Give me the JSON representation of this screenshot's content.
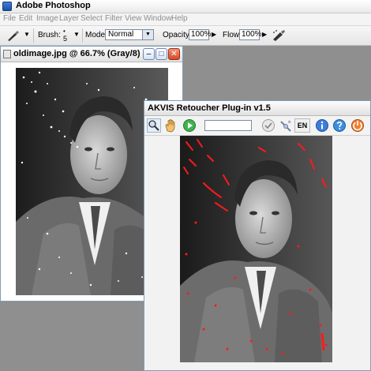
{
  "app": {
    "title": "Adobe Photoshop",
    "menu": [
      "File",
      "Edit",
      "Image",
      "Layer",
      "Select",
      "Filter",
      "View",
      "Window",
      "Help"
    ]
  },
  "options": {
    "brush_label": "Brush:",
    "brush_size": "5",
    "mode_label": "Mode:",
    "mode_value": "Normal",
    "opacity_label": "Opacity:",
    "opacity_value": "100%",
    "flow_label": "Flow:",
    "flow_value": "100%"
  },
  "document": {
    "title": "oldimage.jpg @ 66.7% (Gray/8)",
    "buttons": {
      "minimize": "‒",
      "maximize": "□",
      "close": "✕"
    }
  },
  "plugin": {
    "title": "AKVIS Retoucher Plug-in v1.5",
    "language": "EN",
    "toolbar_icons": [
      "zoom-icon",
      "hand-icon",
      "run-icon",
      "check-icon",
      "settings-icon",
      "info-icon",
      "help-icon",
      "exit-icon"
    ]
  },
  "colors": {
    "defect_marks": "#ff1a1a",
    "window_border": "#7f9db9"
  }
}
